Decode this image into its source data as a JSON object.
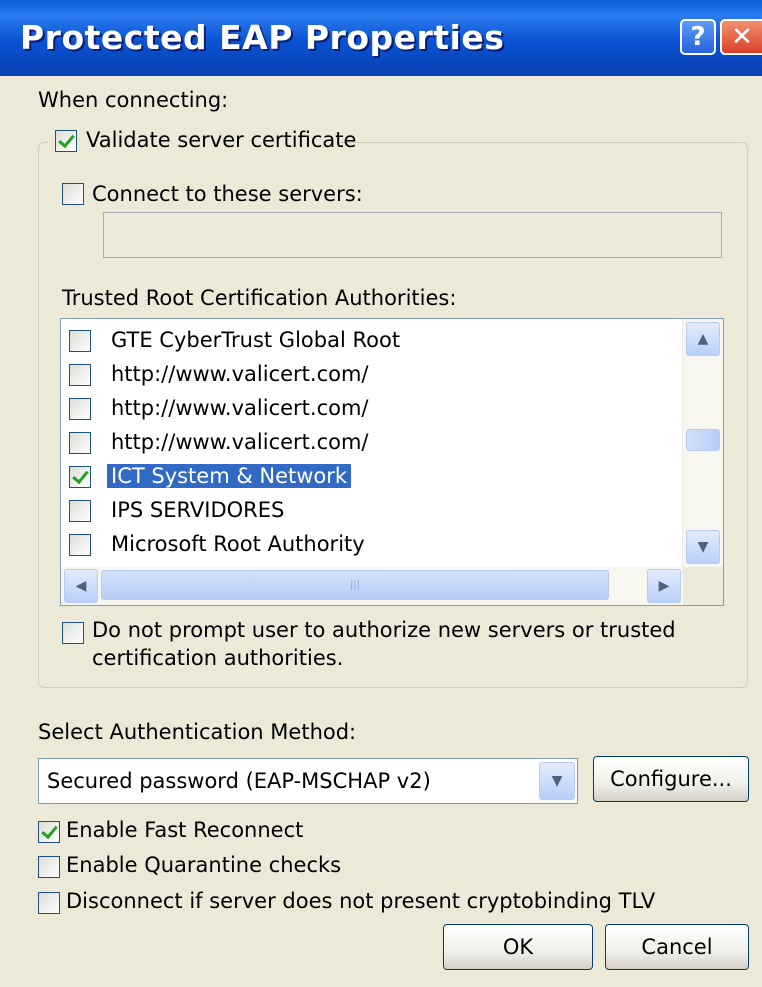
{
  "window": {
    "title": "Protected EAP Properties",
    "help_glyph": "?",
    "close_glyph": "✕"
  },
  "when_connecting_label": "When connecting:",
  "validate_cert": {
    "label": "Validate server certificate",
    "checked": true
  },
  "connect_servers": {
    "label": "Connect to these servers:",
    "checked": false,
    "value": ""
  },
  "trusted_root_label": "Trusted Root Certification Authorities:",
  "ca_list": [
    {
      "label": "GTE CyberTrust Global Root",
      "checked": false,
      "selected": false
    },
    {
      "label": "http://www.valicert.com/",
      "checked": false,
      "selected": false
    },
    {
      "label": "http://www.valicert.com/",
      "checked": false,
      "selected": false
    },
    {
      "label": "http://www.valicert.com/",
      "checked": false,
      "selected": false
    },
    {
      "label": "ICT System & Network",
      "checked": true,
      "selected": true
    },
    {
      "label": "IPS SERVIDORES",
      "checked": false,
      "selected": false
    },
    {
      "label": "Microsoft Root Authority",
      "checked": false,
      "selected": false
    }
  ],
  "do_not_prompt": {
    "line1": "Do not prompt user to authorize new servers or trusted",
    "line2": "certification authorities.",
    "checked": false
  },
  "auth_method_label": "Select Authentication Method:",
  "auth_method_value": "Secured password (EAP-MSCHAP v2)",
  "configure_label": "Configure...",
  "enable_fast_reconnect": {
    "label": "Enable Fast Reconnect",
    "checked": true
  },
  "enable_quarantine": {
    "label": "Enable Quarantine checks",
    "checked": false
  },
  "disconnect_tlv": {
    "label": "Disconnect if server does not present cryptobinding TLV",
    "checked": false
  },
  "ok_label": "OK",
  "cancel_label": "Cancel",
  "icons": {
    "scroll_up": "▲",
    "scroll_down": "▼",
    "scroll_left": "◀",
    "scroll_right": "▶",
    "combo_arrow": "▼",
    "grip": "|||"
  },
  "colors": {
    "dialog_bg": "#ECE9D8",
    "titlebar": "#0A52D0",
    "selection": "#316AC5",
    "check": "#21A121"
  }
}
